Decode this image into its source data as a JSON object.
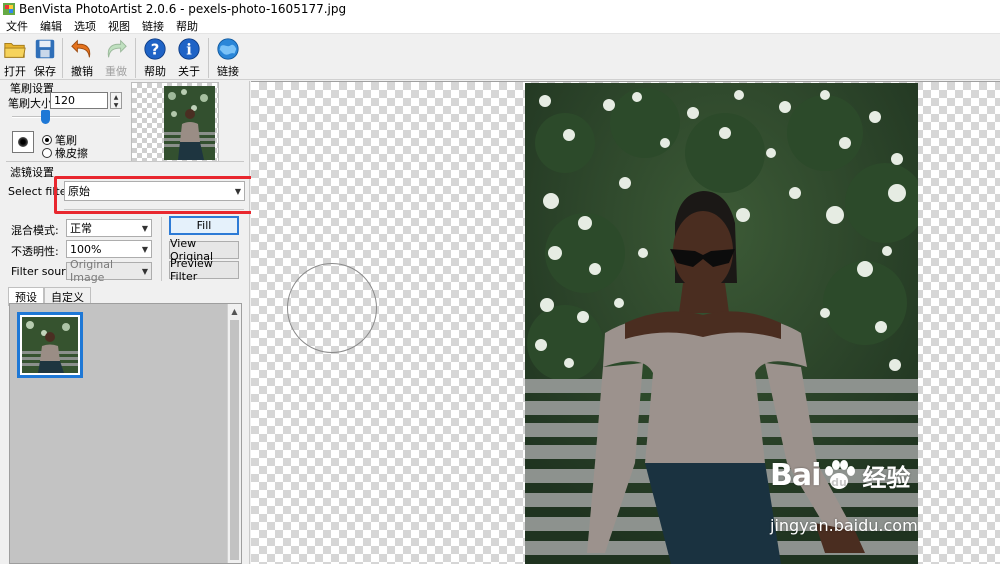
{
  "window": {
    "title": "BenVista PhotoArtist 2.0.6 - pexels-photo-1605177.jpg"
  },
  "menu": [
    "文件",
    "编辑",
    "选项",
    "视图",
    "链接",
    "帮助"
  ],
  "toolbar": {
    "open": "打开",
    "save": "保存",
    "undo": "撤销",
    "redo": "重做",
    "help": "帮助",
    "about": "关于",
    "link": "链接"
  },
  "brush_settings": {
    "group_label": "笔刷设置",
    "size_label": "笔刷大小:",
    "size_value": "120",
    "size_level": 0.3,
    "mode_brush": "笔刷",
    "mode_eraser": "橡皮擦",
    "selected_mode": "笔刷"
  },
  "filter_settings": {
    "group_label": "滤镜设置",
    "select_filter_label": "Select filter:",
    "select_filter_value": "原始",
    "blend_mode_label": "混合模式:",
    "blend_mode_value": "正常",
    "opacity_label": "不透明性:",
    "opacity_value": "100%",
    "filter_source_label": "Filter source:",
    "filter_source_value": "Original Image",
    "fill_button": "Fill",
    "view_original_button": "View Original",
    "preview_filter_button": "Preview Filter"
  },
  "tabs": [
    "预设",
    "自定义"
  ],
  "active_tab": "预设",
  "watermark": {
    "brand": "Bai",
    "product": "经验",
    "url": "jingyan.baidu.com"
  },
  "colors": {
    "highlight": "#e8272e",
    "selection_blue": "#1e78d6",
    "panel_bg": "#f0f0f0"
  }
}
